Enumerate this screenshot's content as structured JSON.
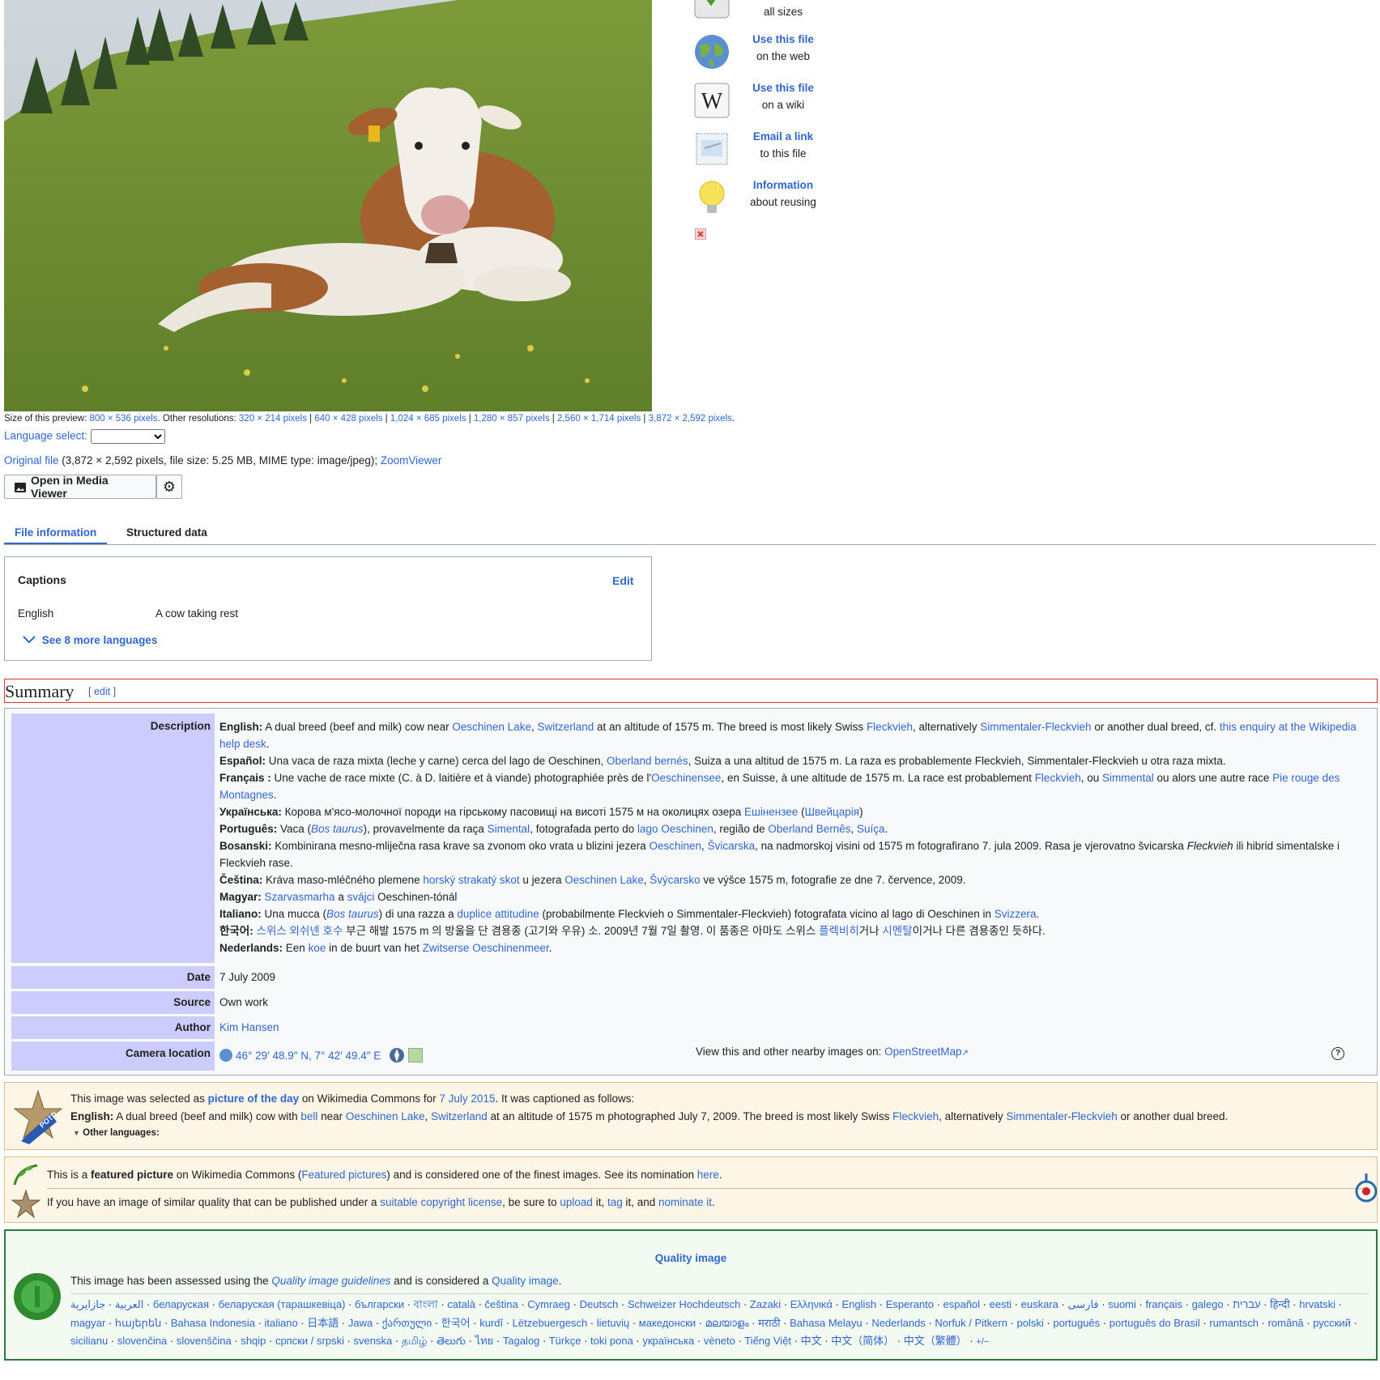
{
  "side_tools": [
    {
      "line1": "",
      "line2": "all sizes",
      "icon": "download-icon"
    },
    {
      "line1": "Use this file",
      "line2": "on the web",
      "icon": "globe-icon"
    },
    {
      "line1": "Use this file",
      "line2": "on a wiki",
      "icon": "wikipedia-icon"
    },
    {
      "line1": "Email a link",
      "line2": "to this file",
      "icon": "envelope-icon"
    },
    {
      "line1": "Information",
      "line2": "about reusing",
      "icon": "lightbulb-icon"
    }
  ],
  "preview": {
    "label": "Size of this preview:",
    "current": "800 × 536 pixels",
    "other_label": ". Other resolutions:",
    "resolutions": [
      "320 × 214 pixels",
      "640 × 428 pixels",
      "1,024 × 685 pixels",
      "1,280 × 857 pixels",
      "2,560 × 1,714 pixels",
      "3,872 × 2,592 pixels"
    ]
  },
  "language_select": {
    "label": "Language select:"
  },
  "original": {
    "link": "Original file",
    "info": " (3,872 × 2,592 pixels, file size: 5.25 MB, MIME type: image/jpeg); ",
    "zoom": "ZoomViewer"
  },
  "media_viewer": {
    "label": "Open in Media Viewer"
  },
  "tabs": [
    "File information",
    "Structured data"
  ],
  "captions": {
    "title": "Captions",
    "edit": "Edit",
    "lang": "English",
    "text": "A cow taking rest",
    "more": "See 8 more languages"
  },
  "summary": {
    "heading": "Summary",
    "edit": "edit"
  },
  "info": {
    "description_label": "Description",
    "date_label": "Date",
    "date": "7 July 2009",
    "source_label": "Source",
    "source": "Own work",
    "author_label": "Author",
    "author": "Kim Hansen",
    "camera_label": "Camera location",
    "camera_coords": "46° 29′ 48.9″ N, 7° 42′ 49.4″ E",
    "nearby_text": "View this and other nearby images on:",
    "nearby_link": "OpenStreetMap",
    "help": "?"
  },
  "descriptions": [
    [
      [
        "b",
        "English:"
      ],
      [
        "t",
        " A dual breed (beef and milk) cow near "
      ],
      [
        "a",
        "Oeschinen Lake"
      ],
      [
        "t",
        ", "
      ],
      [
        "a",
        "Switzerland"
      ],
      [
        "t",
        " at an altitude of 1575 m. The breed is most likely Swiss "
      ],
      [
        "a",
        "Fleckvieh"
      ],
      [
        "t",
        ", alternatively "
      ],
      [
        "a",
        "Simmentaler-Fleckvieh"
      ],
      [
        "t",
        " or another dual breed, cf. "
      ],
      [
        "a",
        "this enquiry at the Wikipedia help desk"
      ],
      [
        "t",
        "."
      ]
    ],
    [
      [
        "b",
        "Español:"
      ],
      [
        "t",
        " Una vaca de raza mixta (leche y carne) cerca del lago de Oeschinen, "
      ],
      [
        "a",
        "Oberland bernés"
      ],
      [
        "t",
        ", Suiza a una altitud de 1575 m. La raza es probablemente Fleckvieh, Simmentaler-Fleckvieh u otra raza mixta."
      ]
    ],
    [
      [
        "b",
        "Français :"
      ],
      [
        "t",
        " Une vache de race mixte (C. à D. laitière et à viande) photographiée près de l'"
      ],
      [
        "a",
        "Oeschinensee"
      ],
      [
        "t",
        ", en Suisse, à une altitude de 1575 m. La race est probablement "
      ],
      [
        "a",
        "Fleckvieh"
      ],
      [
        "t",
        ", ou "
      ],
      [
        "a",
        "Simmental"
      ],
      [
        "t",
        " ou alors une autre race "
      ],
      [
        "a",
        "Pie rouge des Montagnes"
      ],
      [
        "t",
        "."
      ]
    ],
    [
      [
        "b",
        "Українська:"
      ],
      [
        "t",
        " Корова м'ясо-молочної породи на гірському пасовищі на висоті 1575 м на околицях озера "
      ],
      [
        "a",
        "Ешінензее"
      ],
      [
        "t",
        " ("
      ],
      [
        "a",
        "Швейцарія"
      ],
      [
        "t",
        ")"
      ]
    ],
    [
      [
        "b",
        "Português:"
      ],
      [
        "t",
        " Vaca ("
      ],
      [
        "i",
        "Bos taurus"
      ],
      [
        "t",
        "), provavelmente da raça "
      ],
      [
        "a",
        "Simental"
      ],
      [
        "t",
        ", fotografada perto do "
      ],
      [
        "a",
        "lago Oeschinen"
      ],
      [
        "t",
        ", região de "
      ],
      [
        "a",
        "Oberland Bernês"
      ],
      [
        "t",
        ", "
      ],
      [
        "a",
        "Suíça"
      ],
      [
        "t",
        "."
      ]
    ],
    [
      [
        "b",
        "Bosanski:"
      ],
      [
        "t",
        " Kombinirana mesno-mliječna rasa krave sa zvonom oko vrata u blizini jezera "
      ],
      [
        "a",
        "Oeschinen"
      ],
      [
        "t",
        ", "
      ],
      [
        "a",
        "Švicarska"
      ],
      [
        "t",
        ", na nadmorskoj visini od 1575 m fotografirano 7. jula 2009. Rasa je vjerovatno švicarska "
      ],
      [
        "em",
        "Fleckvieh"
      ],
      [
        "t",
        " ili hibrid simentalske i Fleckvieh rase."
      ]
    ],
    [
      [
        "b",
        "Čeština:"
      ],
      [
        "t",
        " Kráva maso-mléčného plemene "
      ],
      [
        "a",
        "horský strakatý skot"
      ],
      [
        "t",
        " u jezera "
      ],
      [
        "a",
        "Oeschinen Lake"
      ],
      [
        "t",
        ", "
      ],
      [
        "a",
        "Švýcarsko"
      ],
      [
        "t",
        " ve výšce 1575 m, fotografie ze dne 7. července, 2009."
      ]
    ],
    [
      [
        "b",
        "Magyar:"
      ],
      [
        "t",
        " "
      ],
      [
        "a",
        "Szarvasmarha"
      ],
      [
        "t",
        " a "
      ],
      [
        "a",
        "svájci"
      ],
      [
        "t",
        " Oeschinen-tónál"
      ]
    ],
    [
      [
        "b",
        "Italiano:"
      ],
      [
        "t",
        " Una mucca ("
      ],
      [
        "i",
        "Bos taurus"
      ],
      [
        "t",
        ") di una razza a "
      ],
      [
        "a",
        "duplice attitudine"
      ],
      [
        "t",
        " (probabilmente Fleckvieh o Simmentaler-Fleckvieh) fotografata vicino al lago di Oeschinen in "
      ],
      [
        "a",
        "Svizzera"
      ],
      [
        "t",
        "."
      ]
    ],
    [
      [
        "b",
        "한국어:"
      ],
      [
        "t",
        " "
      ],
      [
        "a",
        "스위스 외쉬넨 호수"
      ],
      [
        "t",
        " 부근 해발 1575 m 의 방울을 단 겸용종 (고기와 우유) 소. 2009년 7월 7일 촬영. 이 품종은 아마도 스위스 "
      ],
      [
        "a",
        "플렉비히"
      ],
      [
        "t",
        "거나 "
      ],
      [
        "a",
        "시멘탈"
      ],
      [
        "t",
        "이거나 다른 겸용종인 듯하다."
      ]
    ],
    [
      [
        "b",
        "Nederlands:"
      ],
      [
        "t",
        " Een "
      ],
      [
        "a",
        "koe"
      ],
      [
        "t",
        " in de buurt van het "
      ],
      [
        "a",
        "Zwitserse Oeschinenmeer"
      ],
      [
        "t",
        "."
      ]
    ]
  ],
  "potd": {
    "line1": [
      [
        "t",
        "This image was selected as "
      ],
      [
        "ab",
        "picture of the day"
      ],
      [
        "t",
        " on Wikimedia Commons for "
      ],
      [
        "a",
        "7 July 2015"
      ],
      [
        "t",
        ". It was captioned as follows:"
      ]
    ],
    "line2": [
      [
        "b",
        "English:"
      ],
      [
        "t",
        " A dual breed (beef and milk) cow with "
      ],
      [
        "a",
        "bell"
      ],
      [
        "t",
        " near "
      ],
      [
        "a",
        "Oeschinen Lake"
      ],
      [
        "t",
        ", "
      ],
      [
        "a",
        "Switzerland"
      ],
      [
        "t",
        " at an altitude of 1575 m photographed July 7, 2009. The breed is most likely Swiss "
      ],
      [
        "a",
        "Fleckvieh"
      ],
      [
        "t",
        ", alternatively "
      ],
      [
        "a",
        "Simmentaler-Fleckvieh"
      ],
      [
        "t",
        " or another dual breed."
      ]
    ],
    "other": "Other languages:",
    "badge": "POTD"
  },
  "featured": {
    "line1": [
      [
        "t",
        "This is a "
      ],
      [
        "b",
        "featured picture"
      ],
      [
        "t",
        " on Wikimedia Commons ("
      ],
      [
        "a",
        "Featured pictures"
      ],
      [
        "t",
        ") and is considered one of the finest images. See its nomination "
      ],
      [
        "a",
        "here"
      ],
      [
        "t",
        "."
      ]
    ],
    "line2": [
      [
        "t",
        "If you have an image of similar quality that can be published under a "
      ],
      [
        "a",
        "suitable copyright license"
      ],
      [
        "t",
        ", be sure to "
      ],
      [
        "a",
        "upload"
      ],
      [
        "t",
        " it, "
      ],
      [
        "a",
        "tag"
      ],
      [
        "t",
        " it, and "
      ],
      [
        "a",
        "nominate it"
      ],
      [
        "t",
        "."
      ]
    ]
  },
  "quality": {
    "title": "Quality image",
    "line": [
      [
        "t",
        "This image has been assessed using the "
      ],
      [
        "ai",
        "Quality image guidelines"
      ],
      [
        "t",
        " and is considered a "
      ],
      [
        "a",
        "Quality image"
      ],
      [
        "t",
        "."
      ]
    ],
    "languages": [
      "العربية",
      "جازايرية",
      "беларуская",
      "беларуская (тарашкевіца)",
      "български",
      "বাংলা",
      "català",
      "čeština",
      "Cymraeg",
      "Deutsch",
      "Schweizer Hochdeutsch",
      "Zazaki",
      "Ελληνικά",
      "English",
      "Esperanto",
      "español",
      "eesti",
      "euskara",
      "فارسی",
      "suomi",
      "français",
      "galego",
      "עברית",
      "हिन्दी",
      "hrvatski",
      "magyar",
      "հայերեն",
      "Bahasa Indonesia",
      "italiano",
      "日本語",
      "Jawa",
      "ქართული",
      "한국어",
      "kurdî",
      "Lëtzebuergesch",
      "lietuvių",
      "македонски",
      "മലയാളം",
      "मराठी",
      "Bahasa Melayu",
      "Nederlands",
      "Norfuk / Pitkern",
      "polski",
      "português",
      "português do Brasil",
      "rumantsch",
      "română",
      "русский",
      "sicilianu",
      "slovenčina",
      "slovenščina",
      "shqip",
      "српски / srpski",
      "svenska",
      "தமிழ்",
      "తెలుగు",
      "ไทย",
      "Tagalog",
      "Türkçe",
      "toki pona",
      "українська",
      "vèneto",
      "Tiếng Việt",
      "中文",
      "中文（简体）",
      "中文（繁體）"
    ],
    "edit_link": "+/−"
  },
  "colors": {
    "link": "#3366cc",
    "label_bg": "#ccccff",
    "potd_bg": "#fdf6e7",
    "quality_border": "#2a7a3a",
    "summary_border": "#dd3333"
  }
}
